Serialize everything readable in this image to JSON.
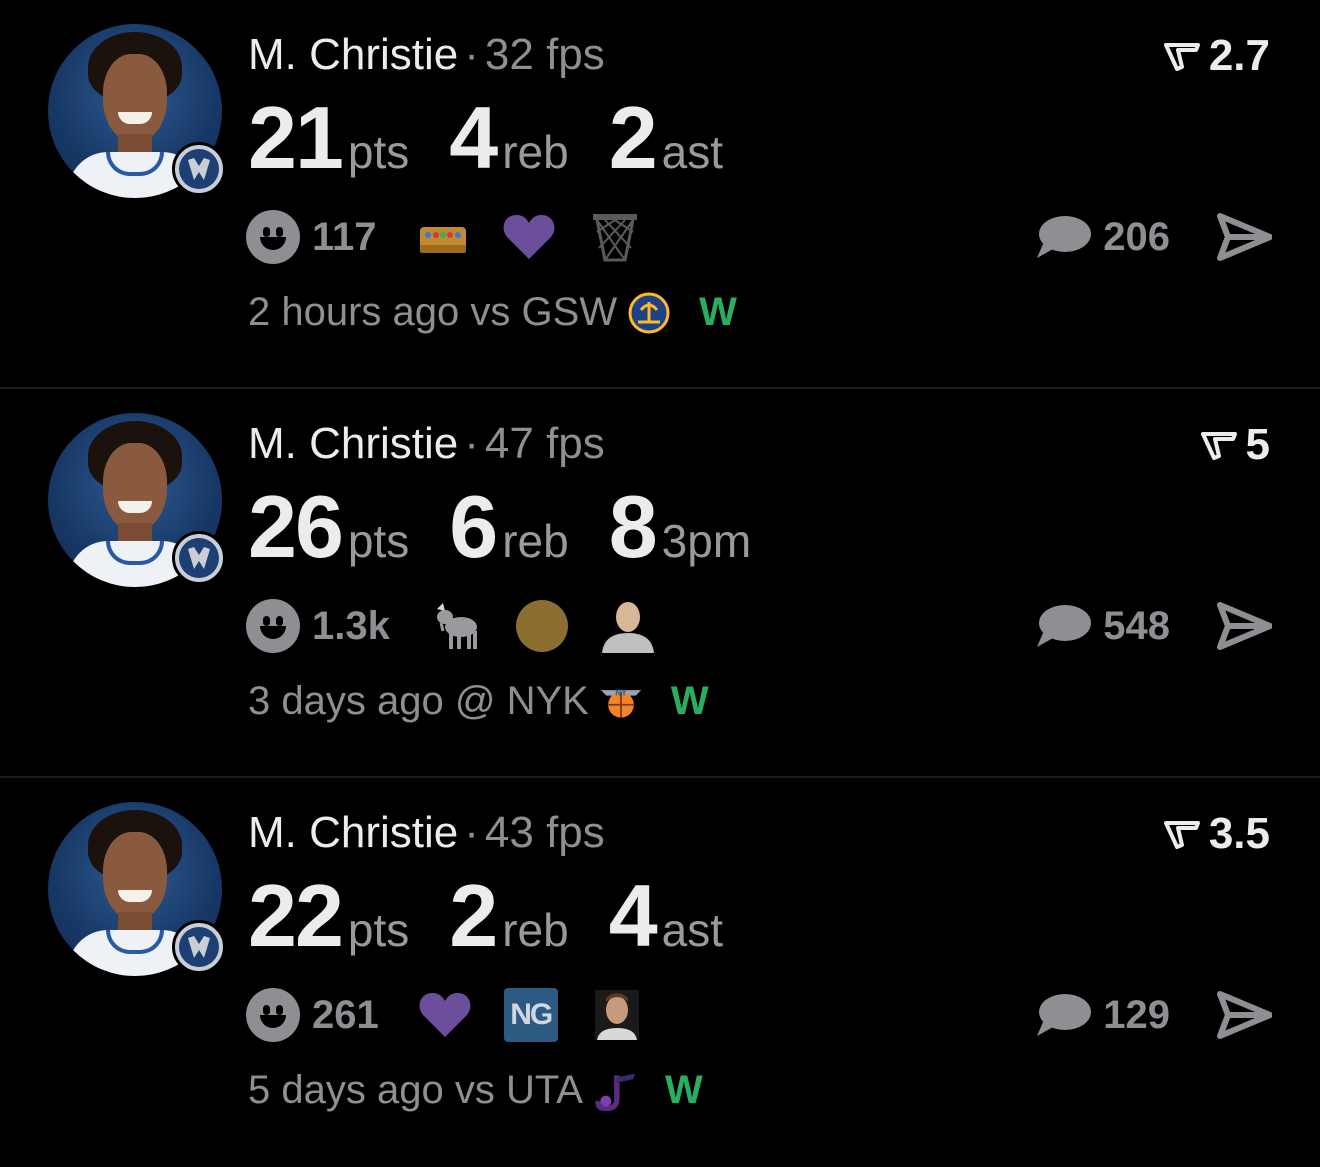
{
  "posts": [
    {
      "player": "M. Christie",
      "separator": "·",
      "fps": "32 fps",
      "rating": "2.7",
      "stats": [
        {
          "value": "21",
          "unit": "pts"
        },
        {
          "value": "4",
          "unit": "reb"
        },
        {
          "value": "2",
          "unit": "ast"
        }
      ],
      "reactions": {
        "count": "117",
        "emojis": [
          "crown-icon",
          "purple-heart-icon",
          "basketball-net-icon"
        ]
      },
      "comments": "206",
      "time": "2 hours ago",
      "location": "vs",
      "opponent": "GSW",
      "opponent_logo": "warriors-logo",
      "result": "W"
    },
    {
      "player": "M. Christie",
      "separator": "·",
      "fps": "47 fps",
      "rating": "5",
      "stats": [
        {
          "value": "26",
          "unit": "pts"
        },
        {
          "value": "6",
          "unit": "reb"
        },
        {
          "value": "8",
          "unit": "3pm"
        }
      ],
      "reactions": {
        "count": "1.3k",
        "emojis": [
          "goat-icon",
          "gold-circle-icon",
          "person-bust-icon"
        ]
      },
      "comments": "548",
      "time": "3 days ago",
      "location": "@",
      "opponent": "NYK",
      "opponent_logo": "knicks-logo",
      "result": "W"
    },
    {
      "player": "M. Christie",
      "separator": "·",
      "fps": "43 fps",
      "rating": "3.5",
      "stats": [
        {
          "value": "22",
          "unit": "pts"
        },
        {
          "value": "2",
          "unit": "reb"
        },
        {
          "value": "4",
          "unit": "ast"
        }
      ],
      "reactions": {
        "count": "261",
        "emojis": [
          "purple-heart-icon",
          "ng-badge-icon",
          "person-photo-icon"
        ],
        "badge_text": "NG"
      },
      "comments": "129",
      "time": "5 days ago",
      "location": "vs",
      "opponent": "UTA",
      "opponent_logo": "jazz-logo",
      "result": "W"
    }
  ],
  "colors": {
    "background": "#000000",
    "muted": "#8e8e93",
    "win": "#27ae60",
    "heart": "#6b4f9a"
  }
}
